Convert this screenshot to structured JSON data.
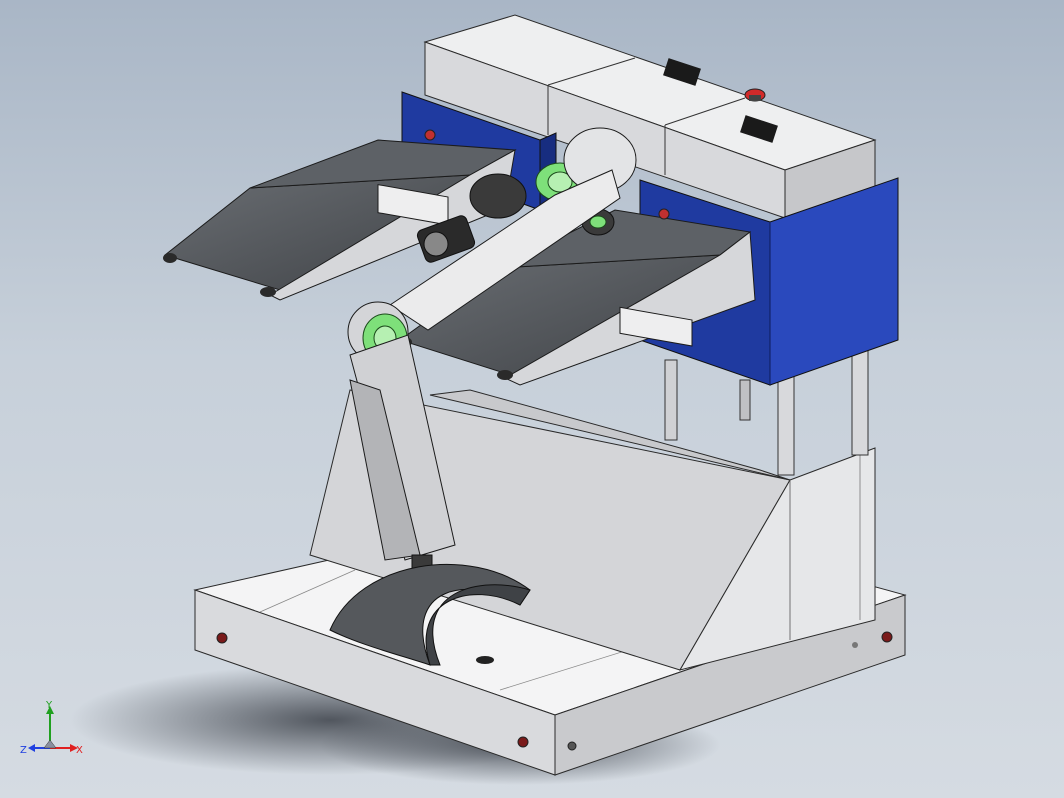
{
  "viewport": {
    "background_top": "#a9b6c6",
    "background_bottom": "#d5dbe2"
  },
  "colors": {
    "housing_gray": "#dcdde0",
    "panel_light": "#f2f2f2",
    "plate_dark": "#55585c",
    "motor_blue": "#1f3aa0",
    "flange_green": "#7ee07a",
    "indicator_red": "#d22a2a",
    "axis_x": "#e02020",
    "axis_y": "#20a020",
    "axis_z": "#2040e0"
  },
  "triad": {
    "x_label": "X",
    "y_label": "Y",
    "z_label": "Z"
  },
  "icons": [
    "view-orientation-triad-icon",
    "emergency-stop-icon",
    "toggle-switch-icon",
    "indicator-lamp-icon"
  ]
}
